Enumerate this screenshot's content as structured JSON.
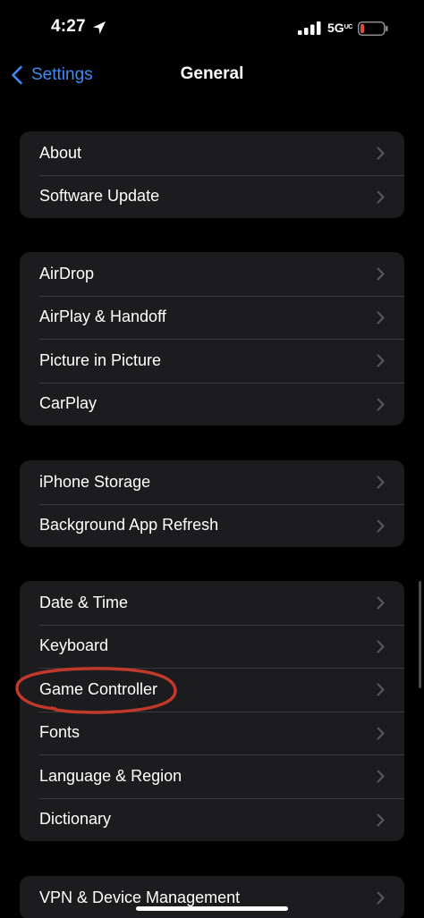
{
  "status_bar": {
    "time": "4:27",
    "network": "5G",
    "network_superscript": "UC",
    "battery_color": "#e5483d",
    "location_icon": "location-arrow-icon",
    "signal_icon": "cellular-signal-icon",
    "battery_icon": "battery-low-icon"
  },
  "nav": {
    "back_label": "Settings",
    "title": "General",
    "accent": "#3e8df7"
  },
  "groups": [
    {
      "items": [
        {
          "label": "About"
        },
        {
          "label": "Software Update"
        }
      ]
    },
    {
      "items": [
        {
          "label": "AirDrop"
        },
        {
          "label": "AirPlay & Handoff"
        },
        {
          "label": "Picture in Picture"
        },
        {
          "label": "CarPlay"
        }
      ]
    },
    {
      "items": [
        {
          "label": "iPhone Storage"
        },
        {
          "label": "Background App Refresh"
        }
      ]
    },
    {
      "items": [
        {
          "label": "Date & Time"
        },
        {
          "label": "Keyboard"
        },
        {
          "label": "Game Controller"
        },
        {
          "label": "Fonts"
        },
        {
          "label": "Language & Region"
        },
        {
          "label": "Dictionary"
        }
      ]
    },
    {
      "items": [
        {
          "label": "VPN & Device Management"
        }
      ]
    }
  ],
  "annotation": {
    "color": "#c0392b",
    "circled_item": "Game Controller"
  },
  "colors": {
    "background": "#000000",
    "cell": "#1c1c1e",
    "separator": "#38383a",
    "chevron": "#5a5a5e"
  }
}
